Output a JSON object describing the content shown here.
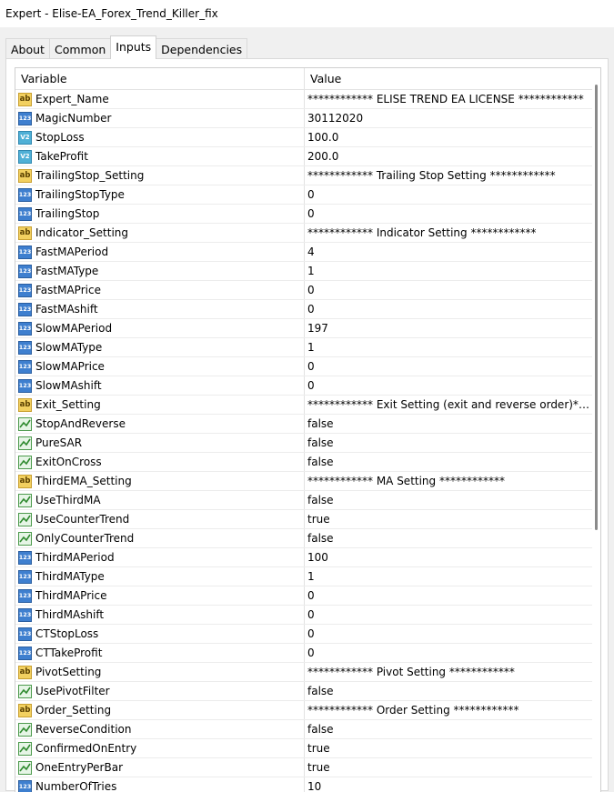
{
  "window": {
    "title": "Expert - Elise-EA_Forex_Trend_Killer_fix"
  },
  "tabs": [
    {
      "label": "About"
    },
    {
      "label": "Common"
    },
    {
      "label": "Inputs",
      "active": true
    },
    {
      "label": "Dependencies"
    }
  ],
  "grid": {
    "headers": {
      "variable": "Variable",
      "value": "Value"
    },
    "rows": [
      {
        "icon": "ab",
        "name": "Expert_Name",
        "value": "************ ELISE TREND EA LICENSE ************"
      },
      {
        "icon": "123",
        "name": "MagicNumber",
        "value": "30112020"
      },
      {
        "icon": "v2",
        "name": "StopLoss",
        "value": "100.0"
      },
      {
        "icon": "v2",
        "name": "TakeProfit",
        "value": "200.0"
      },
      {
        "icon": "ab",
        "name": "TrailingStop_Setting",
        "value": "************ Trailing Stop Setting ************"
      },
      {
        "icon": "123",
        "name": "TrailingStopType",
        "value": "0"
      },
      {
        "icon": "123",
        "name": "TrailingStop",
        "value": "0"
      },
      {
        "icon": "ab",
        "name": "Indicator_Setting",
        "value": "************ Indicator Setting ************"
      },
      {
        "icon": "123",
        "name": "FastMAPeriod",
        "value": "4"
      },
      {
        "icon": "123",
        "name": "FastMAType",
        "value": "1"
      },
      {
        "icon": "123",
        "name": "FastMAPrice",
        "value": "0"
      },
      {
        "icon": "123",
        "name": "FastMAshift",
        "value": "0"
      },
      {
        "icon": "123",
        "name": "SlowMAPeriod",
        "value": "197"
      },
      {
        "icon": "123",
        "name": "SlowMAType",
        "value": "1"
      },
      {
        "icon": "123",
        "name": "SlowMAPrice",
        "value": "0"
      },
      {
        "icon": "123",
        "name": "SlowMAshift",
        "value": "0"
      },
      {
        "icon": "ab",
        "name": "Exit_Setting",
        "value": "************ Exit Setting (exit and reverse order)******..."
      },
      {
        "icon": "bool",
        "name": "StopAndReverse",
        "value": "false"
      },
      {
        "icon": "bool",
        "name": "PureSAR",
        "value": "false"
      },
      {
        "icon": "bool",
        "name": "ExitOnCross",
        "value": "false"
      },
      {
        "icon": "ab",
        "name": "ThirdEMA_Setting",
        "value": "************ MA Setting ************"
      },
      {
        "icon": "bool",
        "name": "UseThirdMA",
        "value": "false"
      },
      {
        "icon": "bool",
        "name": "UseCounterTrend",
        "value": "true"
      },
      {
        "icon": "bool",
        "name": "OnlyCounterTrend",
        "value": "false"
      },
      {
        "icon": "123",
        "name": "ThirdMAPeriod",
        "value": "100"
      },
      {
        "icon": "123",
        "name": "ThirdMAType",
        "value": "1"
      },
      {
        "icon": "123",
        "name": "ThirdMAPrice",
        "value": "0"
      },
      {
        "icon": "123",
        "name": "ThirdMAshift",
        "value": "0"
      },
      {
        "icon": "123",
        "name": "CTStopLoss",
        "value": "0"
      },
      {
        "icon": "123",
        "name": "CTTakeProfit",
        "value": "0"
      },
      {
        "icon": "ab",
        "name": "PivotSetting",
        "value": "************ Pivot Setting ************"
      },
      {
        "icon": "bool",
        "name": "UsePivotFilter",
        "value": "false"
      },
      {
        "icon": "ab",
        "name": "Order_Setting",
        "value": "************ Order Setting ************"
      },
      {
        "icon": "bool",
        "name": "ReverseCondition",
        "value": "false"
      },
      {
        "icon": "bool",
        "name": "ConfirmedOnEntry",
        "value": "true"
      },
      {
        "icon": "bool",
        "name": "OneEntryPerBar",
        "value": "true"
      },
      {
        "icon": "123",
        "name": "NumberOfTries",
        "value": "10"
      }
    ]
  }
}
